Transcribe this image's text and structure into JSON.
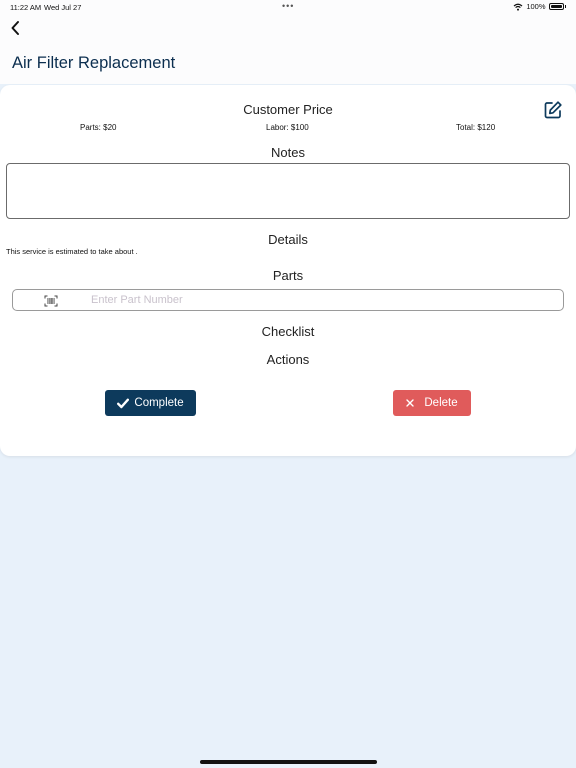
{
  "status_bar": {
    "time": "11:22 AM",
    "date": "Wed Jul 27",
    "dots": "•••",
    "battery": "100%",
    "wifi_icon": "wifi-icon",
    "battery_icon": "battery-icon"
  },
  "nav": {
    "back_icon": "chevron-left-icon",
    "title": "Air Filter Replacement"
  },
  "card": {
    "customer_price_heading": "Customer Price",
    "edit_icon": "edit-icon",
    "parts_price": "Parts: $20",
    "labor_price": "Labor: $100",
    "total_price": "Total: $120",
    "notes_heading": "Notes",
    "notes_value": "",
    "details_heading": "Details",
    "details_text": "This service is estimated to take about .",
    "parts_heading": "Parts",
    "part_number_placeholder": "Enter Part Number",
    "barcode_icon": "barcode-icon",
    "checklist_heading": "Checklist",
    "actions_heading": "Actions",
    "complete_label": "Complete",
    "delete_label": "Delete"
  },
  "colors": {
    "accent": "#0d3a5c",
    "title": "#0b2e4f",
    "danger": "#e05b5b",
    "background": "#e8f1fa"
  }
}
